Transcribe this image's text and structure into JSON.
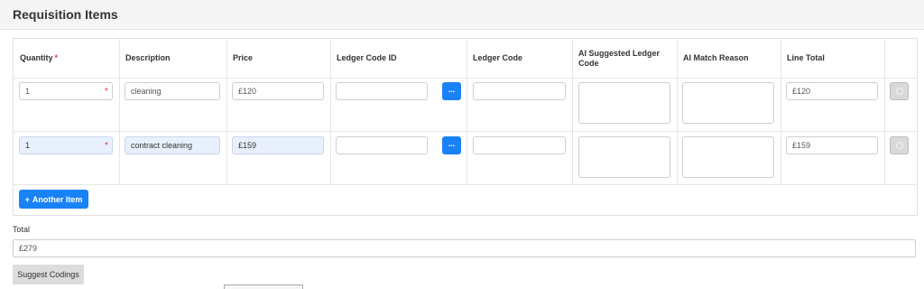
{
  "panel": {
    "title": "Requisition Items"
  },
  "table": {
    "headers": {
      "quantity": "Quantity",
      "description": "Description",
      "price": "Price",
      "ledger_code_id": "Ledger Code ID",
      "ledger_code": "Ledger Code",
      "ai_suggested_line1": "AI Suggested Ledger",
      "ai_suggested_line2": "Code",
      "ai_match_reason": "AI Match Reason",
      "line_total": "Line Total"
    },
    "required_marker": "*",
    "rows": [
      {
        "quantity": "1",
        "description": "cleaning",
        "price": "£120",
        "ledger_code_id": "",
        "ledger_code": "",
        "ai_suggested": "",
        "ai_reason": "",
        "line_total": "£120",
        "lookup_label": "..."
      },
      {
        "quantity": "1",
        "description": "contract cleaning",
        "price": "£159",
        "ledger_code_id": "",
        "ledger_code": "",
        "ai_suggested": "",
        "ai_reason": "",
        "line_total": "£159",
        "lookup_label": "..."
      }
    ],
    "add_item": {
      "icon": "+",
      "label": "Another Item"
    }
  },
  "total": {
    "label": "Total",
    "value": "£279"
  },
  "suggest_button": {
    "label": "Suggest Codings"
  },
  "colors": {
    "primary": "#1a82f7",
    "required": "#e53935",
    "filled_field": "#e8f0fe"
  },
  "icons": {
    "lookup": "ellipsis-icon",
    "remove": "remove-circle-icon",
    "add": "plus-icon"
  }
}
